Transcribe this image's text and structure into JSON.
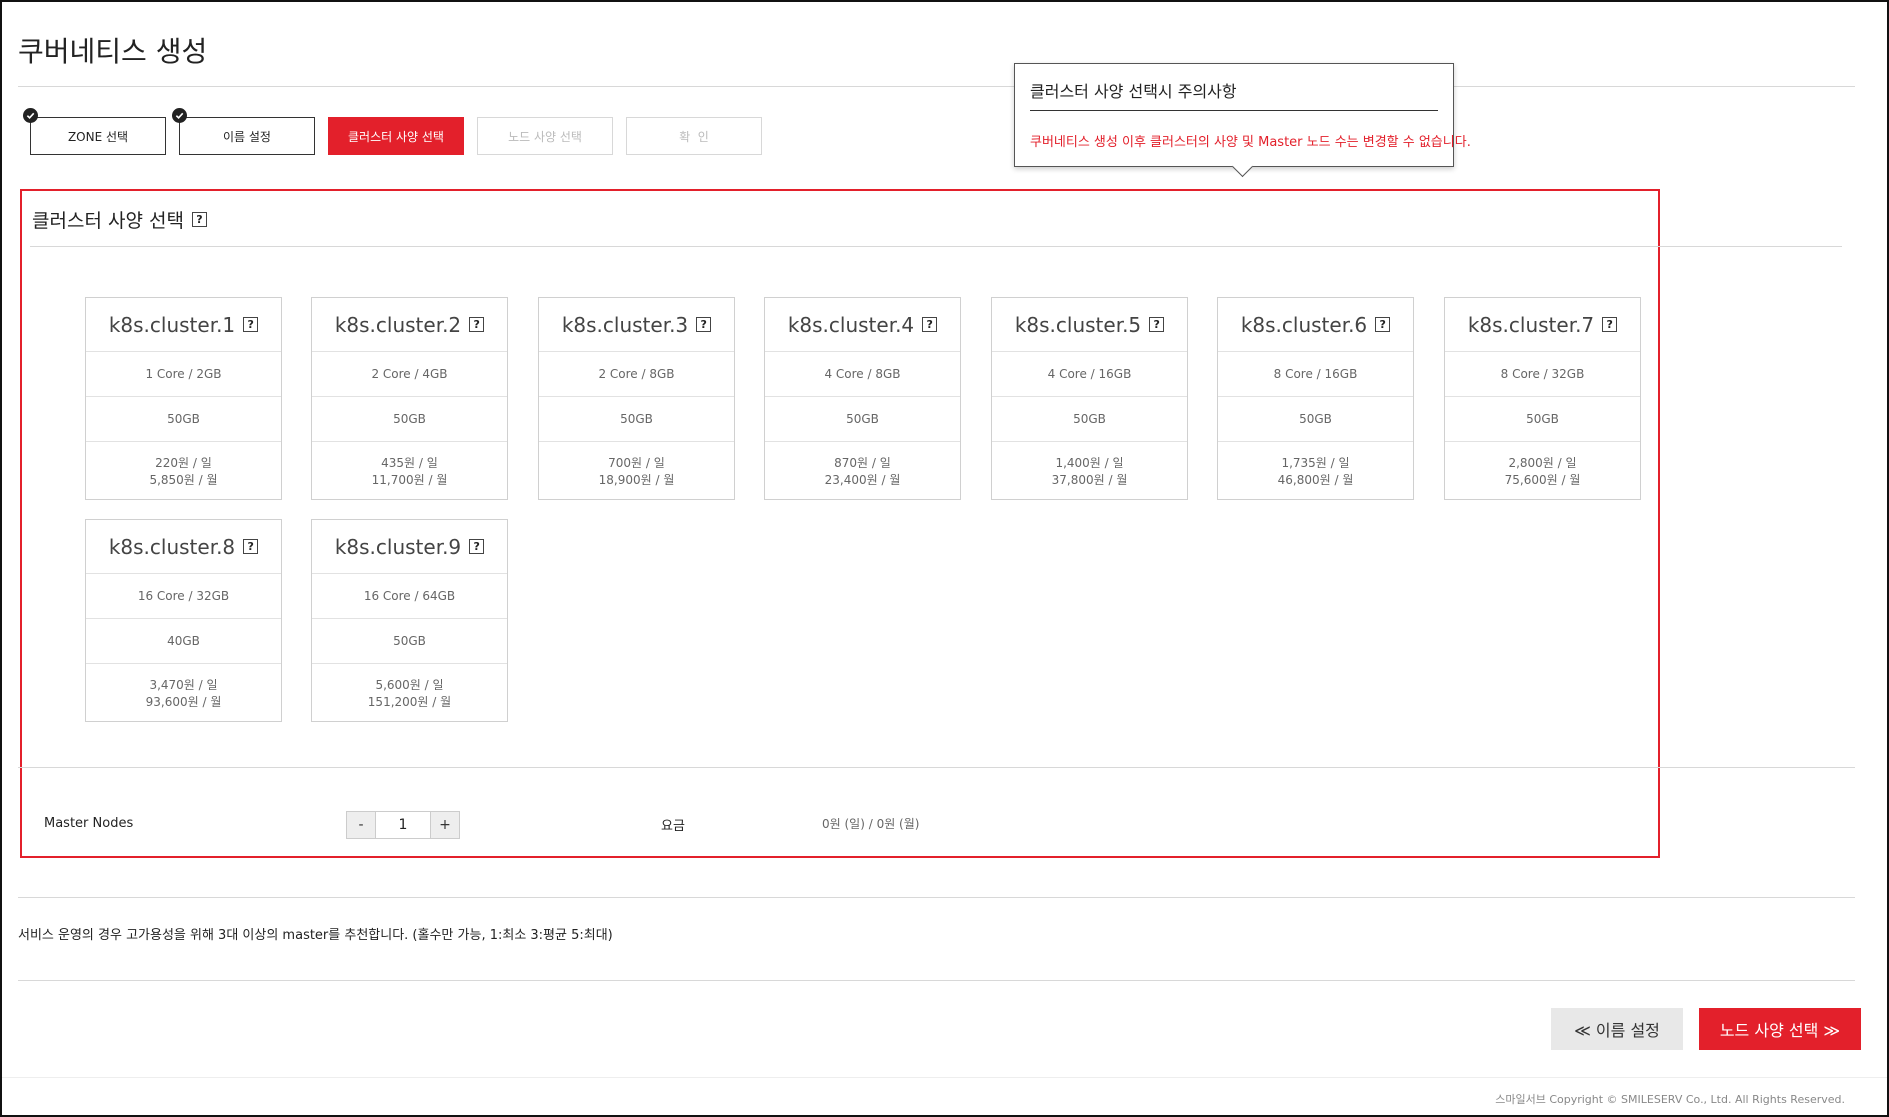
{
  "page": {
    "title": "쿠버네티스 생성"
  },
  "steps": [
    {
      "label": "ZONE 선택",
      "state": "done"
    },
    {
      "label": "이름 설정",
      "state": "done"
    },
    {
      "label": "클러스터 사양 선택",
      "state": "active"
    },
    {
      "label": "노드 사양 선택",
      "state": "disabled"
    },
    {
      "label": "확  인",
      "state": "disabled"
    }
  ],
  "tooltip": {
    "title": "클러스터 사양 선택시 주의사항",
    "body": "쿠버네티스 생성 이후 클러스터의 사양 및 Master 노드 수는 변경할 수 없습니다."
  },
  "section": {
    "title": "클러스터 사양 선택",
    "help_icon": "?"
  },
  "clusters": [
    {
      "name": "k8s.cluster.1",
      "spec": "1 Core / 2GB",
      "disk": "50GB",
      "price_day": "220원 / 일",
      "price_month": "5,850원 / 월"
    },
    {
      "name": "k8s.cluster.2",
      "spec": "2 Core / 4GB",
      "disk": "50GB",
      "price_day": "435원 / 일",
      "price_month": "11,700원 / 월"
    },
    {
      "name": "k8s.cluster.3",
      "spec": "2 Core / 8GB",
      "disk": "50GB",
      "price_day": "700원 / 일",
      "price_month": "18,900원 / 월"
    },
    {
      "name": "k8s.cluster.4",
      "spec": "4 Core / 8GB",
      "disk": "50GB",
      "price_day": "870원 / 일",
      "price_month": "23,400원 / 월"
    },
    {
      "name": "k8s.cluster.5",
      "spec": "4 Core / 16GB",
      "disk": "50GB",
      "price_day": "1,400원 / 일",
      "price_month": "37,800원 / 월"
    },
    {
      "name": "k8s.cluster.6",
      "spec": "8 Core / 16GB",
      "disk": "50GB",
      "price_day": "1,735원 / 일",
      "price_month": "46,800원 / 월"
    },
    {
      "name": "k8s.cluster.7",
      "spec": "8 Core / 32GB",
      "disk": "50GB",
      "price_day": "2,800원 / 일",
      "price_month": "75,600원 / 월"
    },
    {
      "name": "k8s.cluster.8",
      "spec": "16 Core / 32GB",
      "disk": "40GB",
      "price_day": "3,470원 / 일",
      "price_month": "93,600원 / 월"
    },
    {
      "name": "k8s.cluster.9",
      "spec": "16 Core / 64GB",
      "disk": "50GB",
      "price_day": "5,600원 / 일",
      "price_month": "151,200원 / 월"
    }
  ],
  "master": {
    "label": "Master Nodes",
    "minus": "-",
    "value": "1",
    "plus": "+"
  },
  "fee": {
    "label": "요금",
    "value": "0원 (일) / 0원 (월)"
  },
  "notice": "서비스 운영의 경우 고가용성을 위해 3대 이상의 master를 추천합니다. (홀수만 가능, 1:최소 3:평균 5:최대)",
  "buttons": {
    "prev": "≪ 이름 설정",
    "next": "노드 사양 선택 ≫"
  },
  "footer": "스마일서브 Copyright © SMILESERV Co., Ltd. All Rights Reserved.",
  "colors": {
    "accent": "#e3202b",
    "border": "#d0d0d0"
  }
}
